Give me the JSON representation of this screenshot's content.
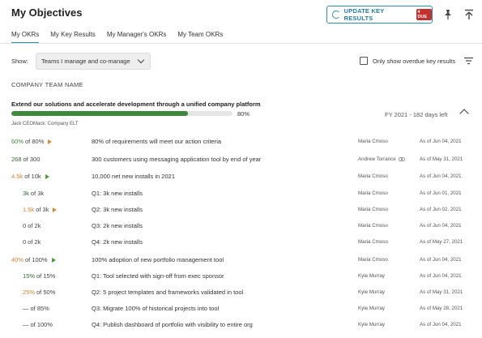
{
  "header": {
    "title": "My Objectives",
    "update_button": "UPDATE KEY RESULTS",
    "due_badge": "4 DUE",
    "accent": "#2a8fb0",
    "due_color": "#c4302b"
  },
  "tabs": [
    {
      "label": "My OKRs",
      "active": true
    },
    {
      "label": "My Key Results",
      "active": false
    },
    {
      "label": "My Manager's OKRs",
      "active": false
    },
    {
      "label": "My Team OKRs",
      "active": false
    }
  ],
  "filters": {
    "show_label": "Show:",
    "show_value": "Teams I manage and co-manage",
    "overdue_label": "Only show overdue key results",
    "overdue_checked": false
  },
  "section": {
    "heading": "COMPANY TEAM NAME"
  },
  "objective": {
    "title": "Extend our solutions and accelerate development through a unified company platform",
    "progress": 0.8,
    "progress_label": "80%",
    "owner": "Jack CEOMack: Company ELT",
    "period": "FY 2021 - 182 days left"
  },
  "key_results": [
    {
      "current": "60%",
      "target": "80%",
      "status": "#3d8a3d",
      "arrow": "orange",
      "name": "80% of requirements will meet our action criteria",
      "owner": "Maria Cmoso",
      "date": "As of Jun 04, 2021",
      "indent": 0,
      "linked": false
    },
    {
      "current": "268",
      "target": "300",
      "status": "#2f6f2f",
      "arrow": "",
      "name": "300 customers using messaging application tool by end of year",
      "owner": "Andrew Torrance",
      "date": "As of May 31, 2021",
      "indent": 0,
      "linked": true
    },
    {
      "current": "4.5k",
      "target": "10k",
      "status": "#d9822b",
      "arrow": "green",
      "name": "10,000 net new installs in 2021",
      "owner": "Maria Cmoso",
      "date": "As of Jun 04, 2021",
      "indent": 0,
      "linked": false
    },
    {
      "current": "3k",
      "target": "3k",
      "status": "#2f6f2f",
      "arrow": "",
      "name": "Q1: 3k new installs",
      "owner": "Maria Cmoso",
      "date": "As of Jun 01, 2021",
      "indent": 1,
      "linked": false
    },
    {
      "current": "1.5k",
      "target": "3k",
      "status": "#d9822b",
      "arrow": "orange",
      "name": "Q2: 3k new installs",
      "owner": "Maria Cmoso",
      "date": "As of Jun 02, 2021",
      "indent": 1,
      "linked": false
    },
    {
      "current": "0",
      "target": "2k",
      "status": "#444444",
      "arrow": "",
      "name": "Q3: 2k new installs",
      "owner": "Maria Cmoso",
      "date": "As of Jun 04, 2021",
      "indent": 1,
      "linked": false
    },
    {
      "current": "0",
      "target": "2k",
      "status": "#444444",
      "arrow": "",
      "name": "Q4: 2k new installs",
      "owner": "Maria Cmoso",
      "date": "As of May 27, 2021",
      "indent": 1,
      "linked": false
    },
    {
      "current": "40%",
      "target": "100%",
      "status": "#d9822b",
      "arrow": "green",
      "name": "100% adoption of new portfolio management tool",
      "owner": "Maria Cmoso",
      "date": "As of Jun 04, 2021",
      "indent": 0,
      "linked": false
    },
    {
      "current": "15%",
      "target": "15%",
      "status": "#2f6f2f",
      "arrow": "",
      "name": "Q1: Tool selected with sign-off from exec sponsor",
      "owner": "Kyle Murray",
      "date": "As of Jun 04, 2021",
      "indent": 1,
      "linked": false
    },
    {
      "current": "25%",
      "target": "50%",
      "status": "#d9822b",
      "arrow": "",
      "name": "Q2: 5 project templates and frameworks validated in tool",
      "owner": "Kyle Murray",
      "date": "As of May 31, 2021",
      "indent": 1,
      "linked": false
    },
    {
      "current": "—",
      "target": "85%",
      "status": "#444444",
      "arrow": "",
      "name": "Q3: Migrate 100% of historical projects into tool",
      "owner": "Kyle Murray",
      "date": "As of May 28, 2021",
      "indent": 1,
      "linked": false
    },
    {
      "current": "—",
      "target": "100%",
      "status": "#444444",
      "arrow": "",
      "name": "Q4: Publish dashboard of portfolio with visibility to entire org",
      "owner": "Kyle Murray",
      "date": "As of Jun 04, 2021",
      "indent": 1,
      "linked": false
    }
  ]
}
